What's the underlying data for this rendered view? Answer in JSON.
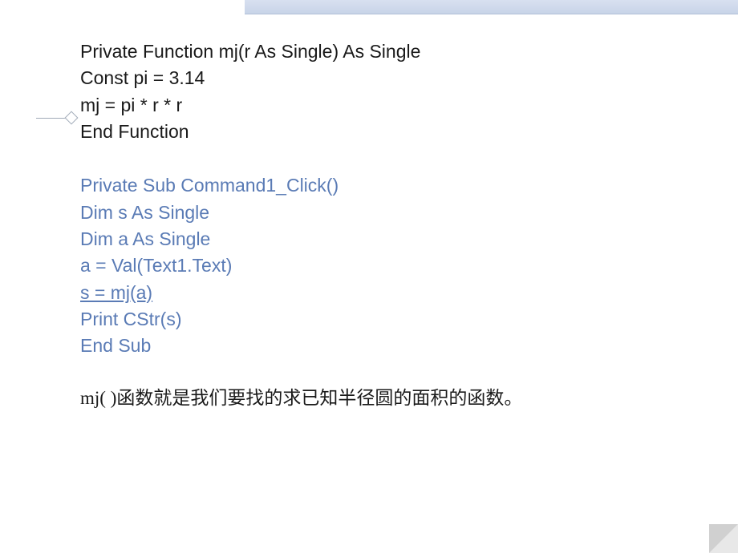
{
  "code_block1": {
    "line1": "Private Function mj(r As Single) As Single",
    "line2": "Const pi = 3.14",
    "line3": "mj = pi * r * r",
    "line4": "End Function"
  },
  "code_block2": {
    "line1": "Private Sub Command1_Click()",
    "line2": "Dim s As Single",
    "line3": "Dim a As Single",
    "line4": "a = Val(Text1.Text)",
    "line5": "s = mj(a)",
    "line6": "Print CStr(s)",
    "line7": "End Sub"
  },
  "note": "mj( )函数就是我们要找的求已知半径圆的面积的函数。"
}
